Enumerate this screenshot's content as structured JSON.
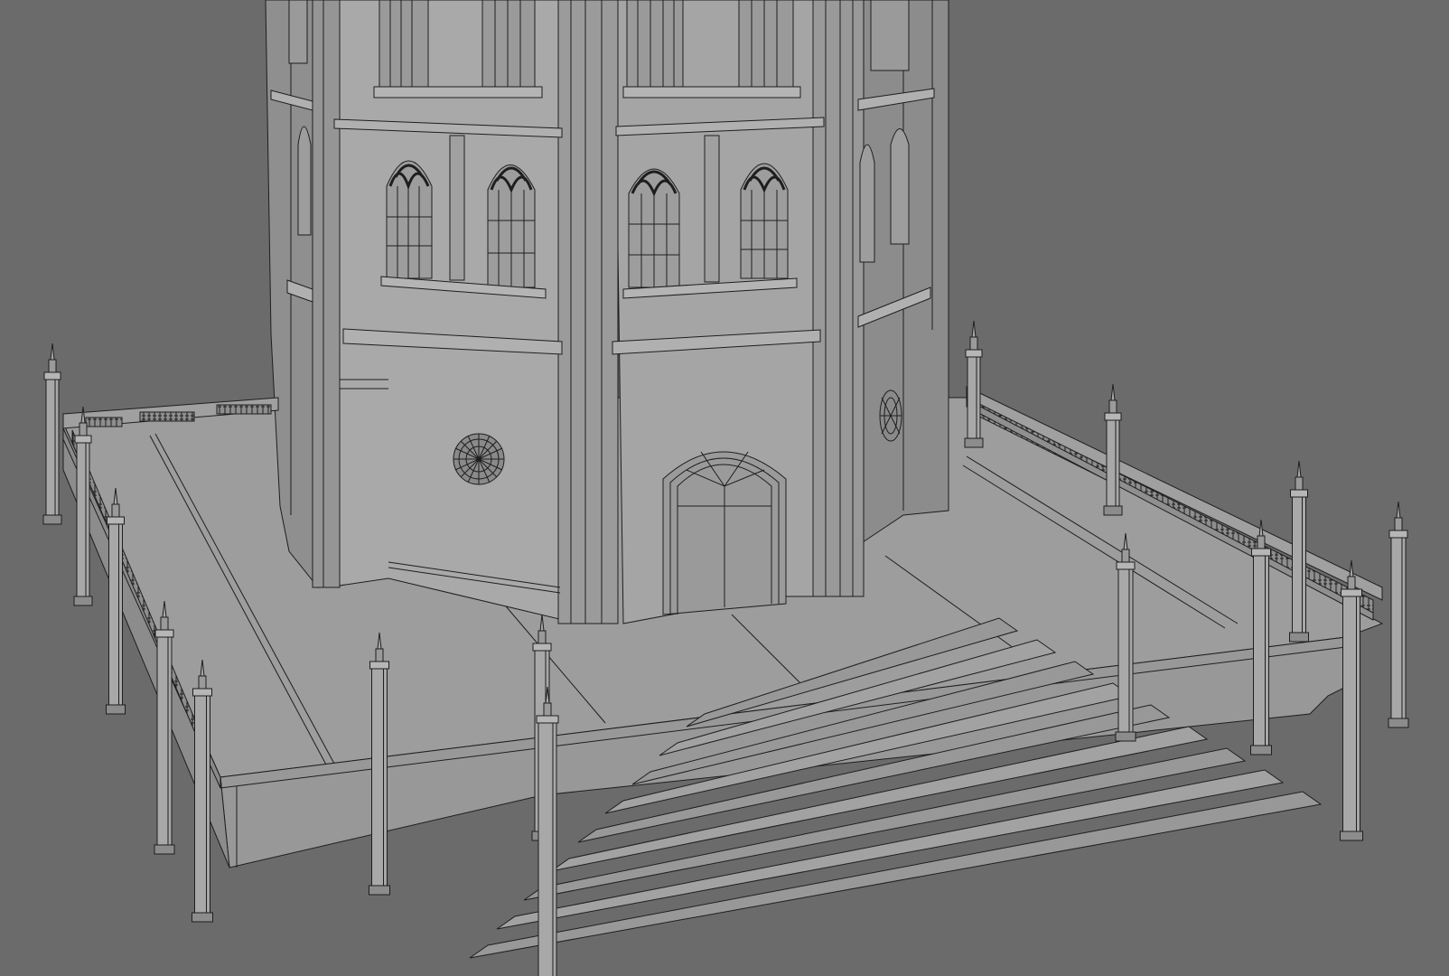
{
  "viewport": {
    "background": "#6b6b6b",
    "surface_light": "#a4a4a4",
    "surface_mid": "#959595",
    "surface_dark": "#8a8a8a",
    "wire": "#1e1e1e",
    "ground": "#9c9c9c"
  },
  "model": {
    "name": "gothic-tower-wireframe",
    "windows_upper": 6,
    "windows_gothic": 6,
    "stairs_steps": 9,
    "pillar_posts": 14
  }
}
